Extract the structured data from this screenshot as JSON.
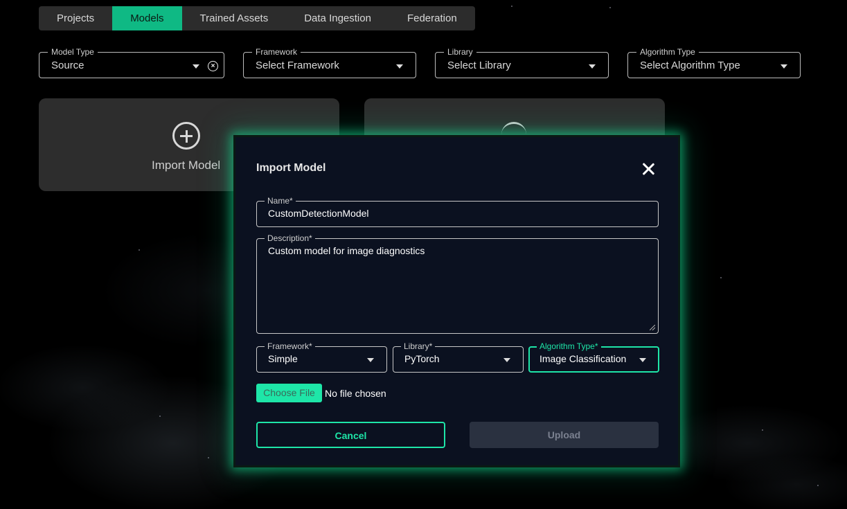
{
  "nav": {
    "tabs": [
      {
        "label": "Projects",
        "active": false
      },
      {
        "label": "Models",
        "active": true
      },
      {
        "label": "Trained Assets",
        "active": false
      },
      {
        "label": "Data Ingestion",
        "active": false
      },
      {
        "label": "Federation",
        "active": false
      }
    ]
  },
  "filters": {
    "model_type": {
      "label": "Model Type",
      "value": "Source"
    },
    "framework": {
      "label": "Framework",
      "value": "Select Framework"
    },
    "library": {
      "label": "Library",
      "value": "Select Library"
    },
    "algorithm_type": {
      "label": "Algorithm Type",
      "value": "Select Algorithm Type"
    }
  },
  "cards": {
    "import": {
      "label": "Import Model",
      "icon": "plus-circle-icon"
    },
    "second": {
      "icon": "loading-spinner-icon"
    }
  },
  "modal": {
    "title": "Import Model",
    "name": {
      "label": "Name*",
      "value": "CustomDetectionModel"
    },
    "description": {
      "label": "Description*",
      "value": "Custom model for image diagnostics"
    },
    "framework": {
      "label": "Framework*",
      "value": "Simple"
    },
    "library": {
      "label": "Library*",
      "value": "PyTorch"
    },
    "algorithm_type": {
      "label": "Algorithm Type*",
      "value": "Image Classification"
    },
    "file": {
      "button_label": "Choose File",
      "status": "No file chosen"
    },
    "cancel_label": "Cancel",
    "upload_label": "Upload"
  },
  "colors": {
    "accent": "#1ee6a8",
    "tab_active": "#0fb984",
    "modal_bg": "#0b1120",
    "card_bg": "#2d2d2d"
  }
}
